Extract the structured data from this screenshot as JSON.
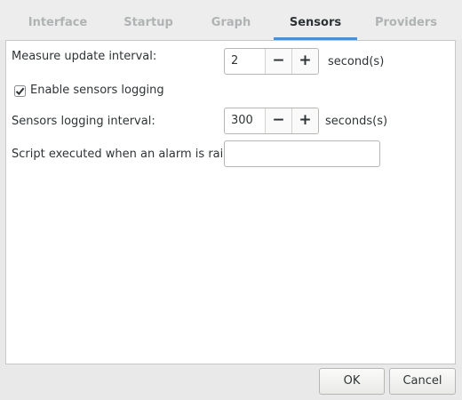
{
  "tabs": [
    {
      "label": "Interface",
      "active": false
    },
    {
      "label": "Startup",
      "active": false
    },
    {
      "label": "Graph",
      "active": false
    },
    {
      "label": "Sensors",
      "active": true
    },
    {
      "label": "Providers",
      "active": false
    }
  ],
  "sensors": {
    "measure_interval_label": "Measure update interval:",
    "measure_interval_value": "2",
    "measure_interval_unit": "second(s)",
    "logging_checkbox_label": "Enable sensors logging",
    "logging_checkbox_checked": true,
    "logging_interval_label": "Sensors logging interval:",
    "logging_interval_value": "300",
    "logging_interval_unit": "seconds(s)",
    "alarm_script_label": "Script executed when an alarm is raised:",
    "alarm_script_value": ""
  },
  "spin": {
    "minus": "−",
    "plus": "+"
  },
  "buttons": {
    "ok": "OK",
    "cancel": "Cancel"
  },
  "colors": {
    "accent": "#4a90d9",
    "panel_bg": "#ffffff",
    "window_bg": "#e9e9e9"
  }
}
